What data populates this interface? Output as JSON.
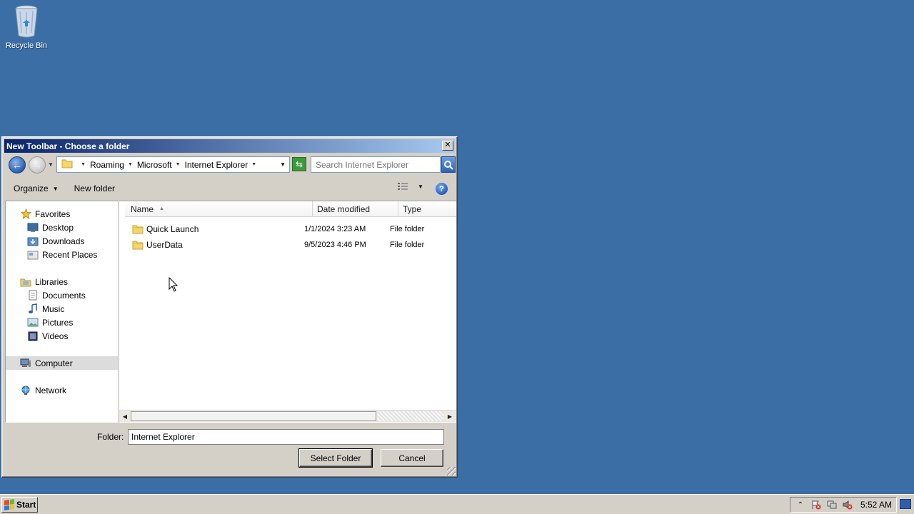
{
  "desktop": {
    "recycle_bin_label": "Recycle Bin"
  },
  "dialog": {
    "title": "New Toolbar - Choose a folder",
    "close_glyph": "✕",
    "breadcrumbs": [
      "Roaming",
      "Microsoft",
      "Internet Explorer"
    ],
    "search_placeholder": "Search Internet Explorer",
    "toolbar": {
      "organize_label": "Organize",
      "new_folder_label": "New folder",
      "help_glyph": "?"
    },
    "nav": {
      "favorites": "Favorites",
      "desktop": "Desktop",
      "downloads": "Downloads",
      "recent_places": "Recent Places",
      "libraries": "Libraries",
      "documents": "Documents",
      "music": "Music",
      "pictures": "Pictures",
      "videos": "Videos",
      "computer": "Computer",
      "network": "Network"
    },
    "columns": {
      "name": "Name",
      "date_modified": "Date modified",
      "type": "Type"
    },
    "files": [
      {
        "name": "Quick Launch",
        "date": "1/1/2024 3:23 AM",
        "type": "File folder"
      },
      {
        "name": "UserData",
        "date": "9/5/2023 4:46 PM",
        "type": "File folder"
      }
    ],
    "folder_label": "Folder:",
    "folder_value": "Internet Explorer",
    "select_button": "Select Folder",
    "cancel_button": "Cancel"
  },
  "taskbar": {
    "start_label": "Start",
    "clock": "5:52 AM"
  },
  "colors": {
    "desktop_bg": "#3a6ea5",
    "dialog_face": "#d4d0c8",
    "title_active": "#0a246a"
  }
}
